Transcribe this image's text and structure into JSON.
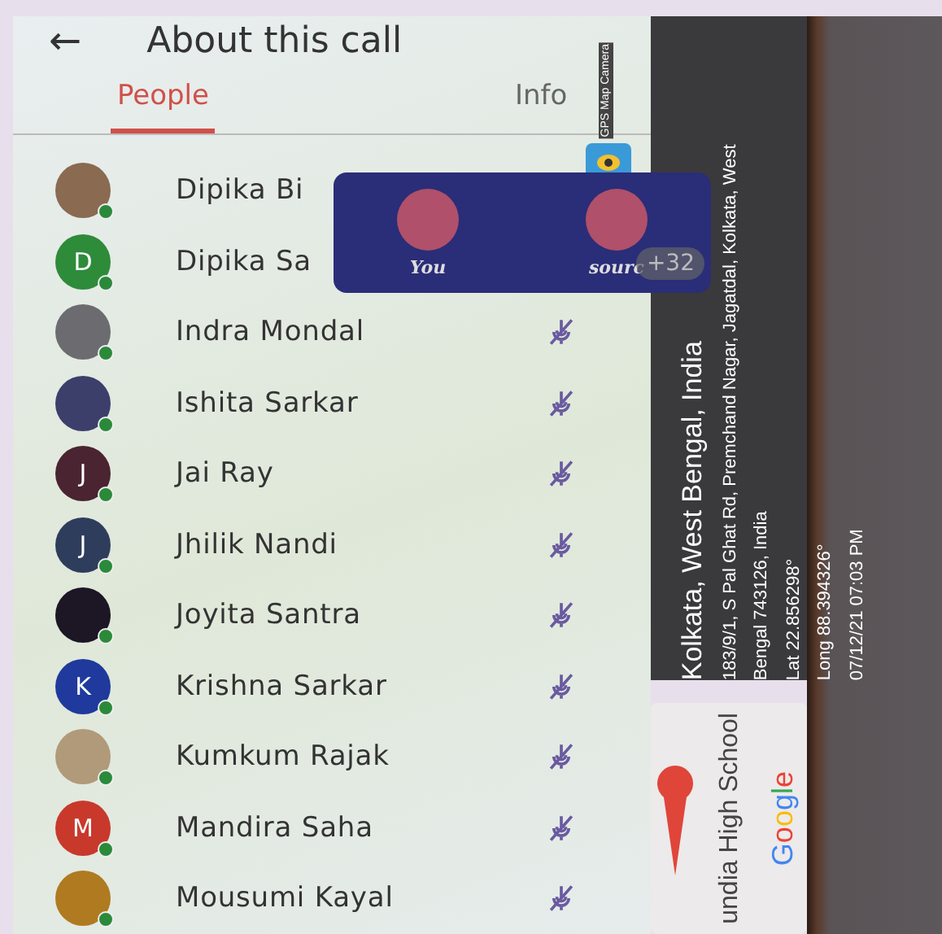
{
  "header": {
    "back_icon": "←",
    "title": "About this call"
  },
  "tabs": [
    {
      "label": "People",
      "selected": true
    },
    {
      "label": "Info",
      "selected": false
    }
  ],
  "participants": [
    {
      "name": "Dipika Bi",
      "avatar": {
        "kind": "photo",
        "color": "#8a6a50"
      },
      "muted": false
    },
    {
      "name": "Dipika Sa",
      "avatar": {
        "kind": "initial",
        "letter": "D",
        "color": "#2e8b3a"
      },
      "muted": false
    },
    {
      "name": "Indra Mondal",
      "avatar": {
        "kind": "photo",
        "color": "#6b6b70"
      },
      "muted": true
    },
    {
      "name": "Ishita Sarkar",
      "avatar": {
        "kind": "photo",
        "color": "#3b3f6a"
      },
      "muted": true
    },
    {
      "name": "Jai Ray",
      "avatar": {
        "kind": "initial",
        "letter": "J",
        "color": "#4a2430"
      },
      "muted": true
    },
    {
      "name": "Jhilik Nandi",
      "avatar": {
        "kind": "initial",
        "letter": "J",
        "color": "#2f3d5c"
      },
      "muted": true
    },
    {
      "name": "Joyita Santra",
      "avatar": {
        "kind": "initial",
        "color": "#1c1625"
      },
      "muted": true
    },
    {
      "name": "Krishna Sarkar",
      "avatar": {
        "kind": "initial",
        "letter": "K",
        "color": "#1f3a9c"
      },
      "muted": true
    },
    {
      "name": "Kumkum Rajak",
      "avatar": {
        "kind": "photo",
        "color": "#b09a7a"
      },
      "muted": true
    },
    {
      "name": "Mandira Saha",
      "avatar": {
        "kind": "initial",
        "letter": "M",
        "color": "#c8392c"
      },
      "muted": true
    },
    {
      "name": "Mousumi Kayal",
      "avatar": {
        "kind": "photo",
        "color": "#b07a20"
      },
      "muted": true
    }
  ],
  "call_tile": {
    "tiles": [
      {
        "label": "You"
      },
      {
        "label": "sourc"
      }
    ],
    "extra_count": "+32"
  },
  "gps_stamp": {
    "app_name": "GPS Map Camera",
    "place": "Kolkata, West Bengal, India",
    "address_lines": [
      "183/9/1, S Pal Ghat Rd, Premchand Nagar, Jagatdal, Kolkata, West",
      "Bengal 743126, India"
    ],
    "lat": "Lat 22.856298°",
    "long": "Long 88.394326°",
    "datetime": "07/12/21 07:03 PM",
    "map_label": "undia High School",
    "map_brand": "Google"
  }
}
